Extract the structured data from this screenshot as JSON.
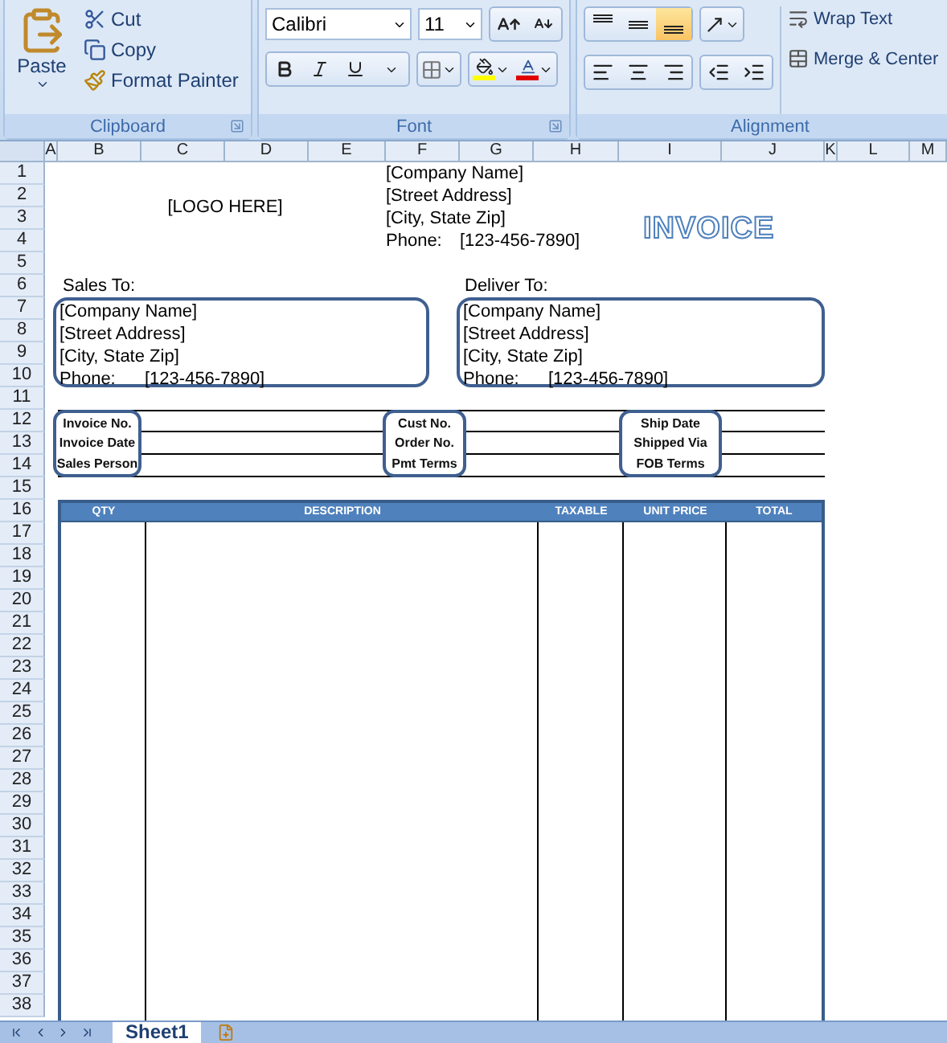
{
  "ribbon": {
    "clipboard": {
      "label": "Clipboard",
      "paste": "Paste",
      "actions": [
        {
          "kind": "cut",
          "label": "Cut"
        },
        {
          "kind": "copy",
          "label": "Copy"
        },
        {
          "kind": "painter",
          "label": "Format Painter"
        }
      ]
    },
    "font": {
      "label": "Font",
      "font_name": "Calibri",
      "font_size": "11"
    },
    "alignment": {
      "label": "Alignment",
      "vertical": [
        {
          "kind": "top",
          "selected": false
        },
        {
          "kind": "middle",
          "selected": false
        },
        {
          "kind": "bottom",
          "selected": true
        }
      ],
      "wrap_text": "Wrap Text",
      "merge_center": "Merge & Center"
    }
  },
  "columns": [
    "A",
    "B",
    "C",
    "D",
    "E",
    "F",
    "G",
    "H",
    "I",
    "J",
    "K",
    "L",
    "M"
  ],
  "rows": [
    "1",
    "2",
    "3",
    "4",
    "5",
    "6",
    "7",
    "8",
    "9",
    "10",
    "11",
    "12",
    "13",
    "14",
    "15",
    "16",
    "17",
    "18",
    "19",
    "20",
    "21",
    "22",
    "23",
    "24",
    "25",
    "26",
    "27",
    "28",
    "29",
    "30",
    "31",
    "32",
    "33",
    "34",
    "35",
    "36",
    "37",
    "38"
  ],
  "sheet": {
    "company": {
      "lines": [
        "[Company Name]",
        "[Street Address]",
        "[City, State Zip]"
      ],
      "phone_label": "Phone:",
      "phone": "[123-456-7890]"
    },
    "logo": "[LOGO HERE]",
    "title": "INVOICE",
    "addresses": [
      {
        "heading": "Sales To:",
        "lines": [
          "[Company Name]",
          "[Street Address]",
          "[City, State Zip]"
        ],
        "phone_label": "Phone:",
        "phone": "[123-456-7890]"
      },
      {
        "heading": "Deliver To:",
        "lines": [
          "[Company Name]",
          "[Street Address]",
          "[City, State Zip]"
        ],
        "phone_label": "Phone:",
        "phone": "[123-456-7890]"
      }
    ],
    "info_blocks": [
      [
        "Invoice No.",
        "Invoice Date",
        "Sales Person"
      ],
      [
        "Cust No.",
        "Order No.",
        "Pmt Terms"
      ],
      [
        "Ship Date",
        "Shipped Via",
        "FOB Terms"
      ]
    ],
    "items_table": {
      "columns": [
        "QTY",
        "DESCRIPTION",
        "TAXABLE",
        "UNIT PRICE",
        "TOTAL"
      ]
    }
  },
  "sheet_tabs": [
    {
      "label": "Sheet1",
      "selected": true
    }
  ]
}
